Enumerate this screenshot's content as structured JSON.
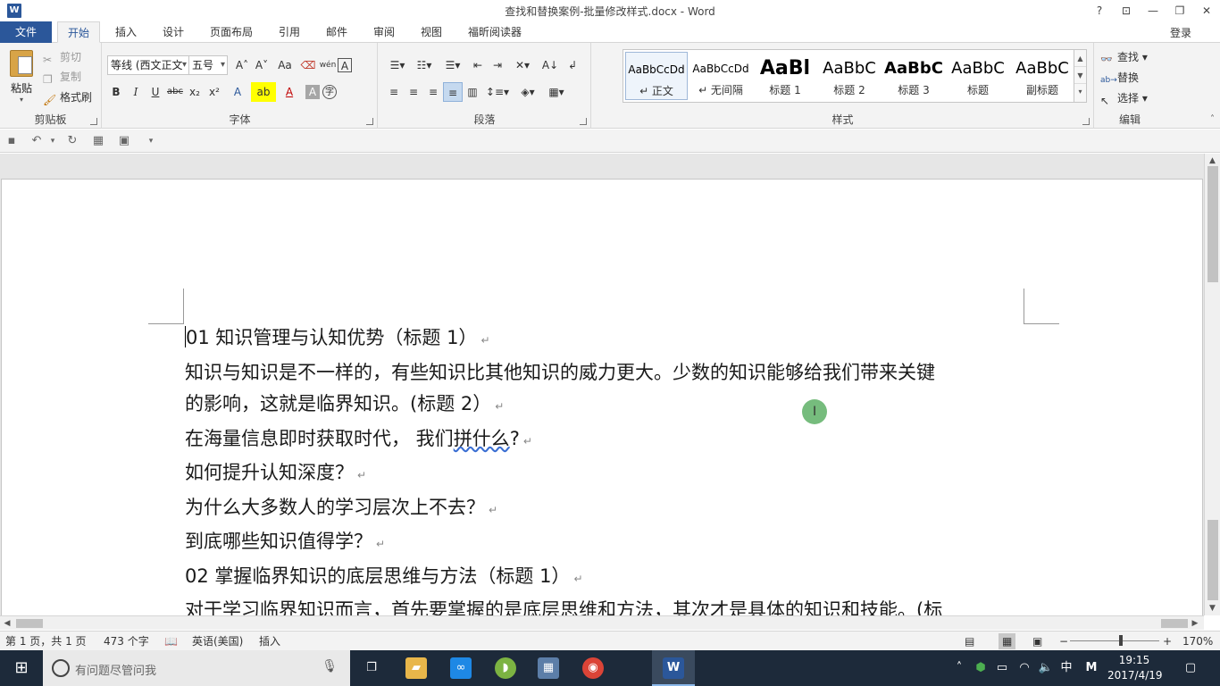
{
  "window": {
    "title": "查找和替换案例-批量修改样式.docx - Word",
    "buttons": [
      "?",
      "⊡",
      "—",
      "❐",
      "✕"
    ]
  },
  "tabs": {
    "file": "文件",
    "items": [
      "开始",
      "插入",
      "设计",
      "页面布局",
      "引用",
      "邮件",
      "审阅",
      "视图",
      "福昕阅读器"
    ],
    "active_index": 0,
    "login": "登录"
  },
  "clipboard": {
    "paste": "粘贴",
    "cut": "剪切",
    "copy": "复制",
    "format_painter": "格式刷",
    "label": "剪贴板"
  },
  "font": {
    "name": "等线 (西文正文",
    "size": "五号",
    "label": "字体",
    "grow": "A˄",
    "shrink": "A˅",
    "case": "Aa",
    "clear": "⌫",
    "phonetic": "wén",
    "border": "A",
    "bold": "B",
    "italic": "I",
    "underline": "U",
    "strike": "abc",
    "sub": "x₂",
    "sup": "x²",
    "effects": "A",
    "highlight": "ab",
    "color": "A",
    "shade": "A",
    "enclose": "字"
  },
  "paragraph": {
    "label": "段落"
  },
  "styles": {
    "label": "样式",
    "items": [
      {
        "preview": "AaBbCcDd",
        "name": "↵ 正文"
      },
      {
        "preview": "AaBbCcDd",
        "name": "↵ 无间隔"
      },
      {
        "preview": "AaBl",
        "name": "标题 1"
      },
      {
        "preview": "AaBbC",
        "name": "标题 2"
      },
      {
        "preview": "AaBbC",
        "name": "标题 3"
      },
      {
        "preview": "AaBbC",
        "name": "标题"
      },
      {
        "preview": "AaBbC",
        "name": "副标题"
      }
    ]
  },
  "editing": {
    "label": "编辑",
    "find": "查找",
    "replace": "替换",
    "select": "选择"
  },
  "document": {
    "paragraphs": [
      {
        "text": "01  知识管理与认知优势（标题 1）"
      },
      {
        "text": "知识与知识是不一样的，有些知识比其他知识的威力更大。少数的知识能够给我们带来关键"
      },
      {
        "text": "的影响，这就是临界知识。(标题 2）"
      },
      {
        "text_before": "在海量信息即时获取时代，  我们",
        "text_squiggle": "拼什么",
        "text_after": "?"
      },
      {
        "text": "如何提升认知深度？"
      },
      {
        "text": "为什么大多数人的学习层次上不去？"
      },
      {
        "text": "到底哪些知识值得学？"
      },
      {
        "text": "02  掌握临界知识的底层思维与方法（标题 1）"
      },
      {
        "text": "对于学习临界知识而言，首先要掌握的是底层思维和方法，其次才是具体的知识和技能。(标"
      }
    ],
    "para_mark": "↵"
  },
  "status": {
    "page": "第 1 页，共 1 页",
    "words": "473 个字",
    "language": "英语(美国)",
    "mode": "插入",
    "zoom": "170%"
  },
  "taskbar": {
    "search_placeholder": "有问题尽管问我",
    "ime": "中",
    "ime_mode": "M",
    "time": "19:15",
    "date": "2017/4/19"
  }
}
